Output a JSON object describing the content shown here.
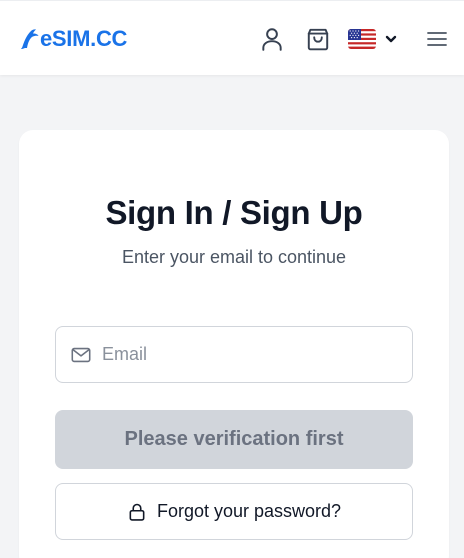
{
  "header": {
    "logo_text": "eSIM.CC",
    "brand_color": "#1a73e8",
    "icons": [
      "user-icon",
      "shopping-bag-icon",
      "us-flag-icon",
      "chevron-down-icon",
      "hamburger-menu-icon"
    ]
  },
  "auth": {
    "title": "Sign In / Sign Up",
    "subtitle": "Enter your email to continue",
    "email_placeholder": "Email",
    "email_value": "",
    "verify_label": "Please verification first",
    "forgot_label": "Forgot your password?"
  }
}
